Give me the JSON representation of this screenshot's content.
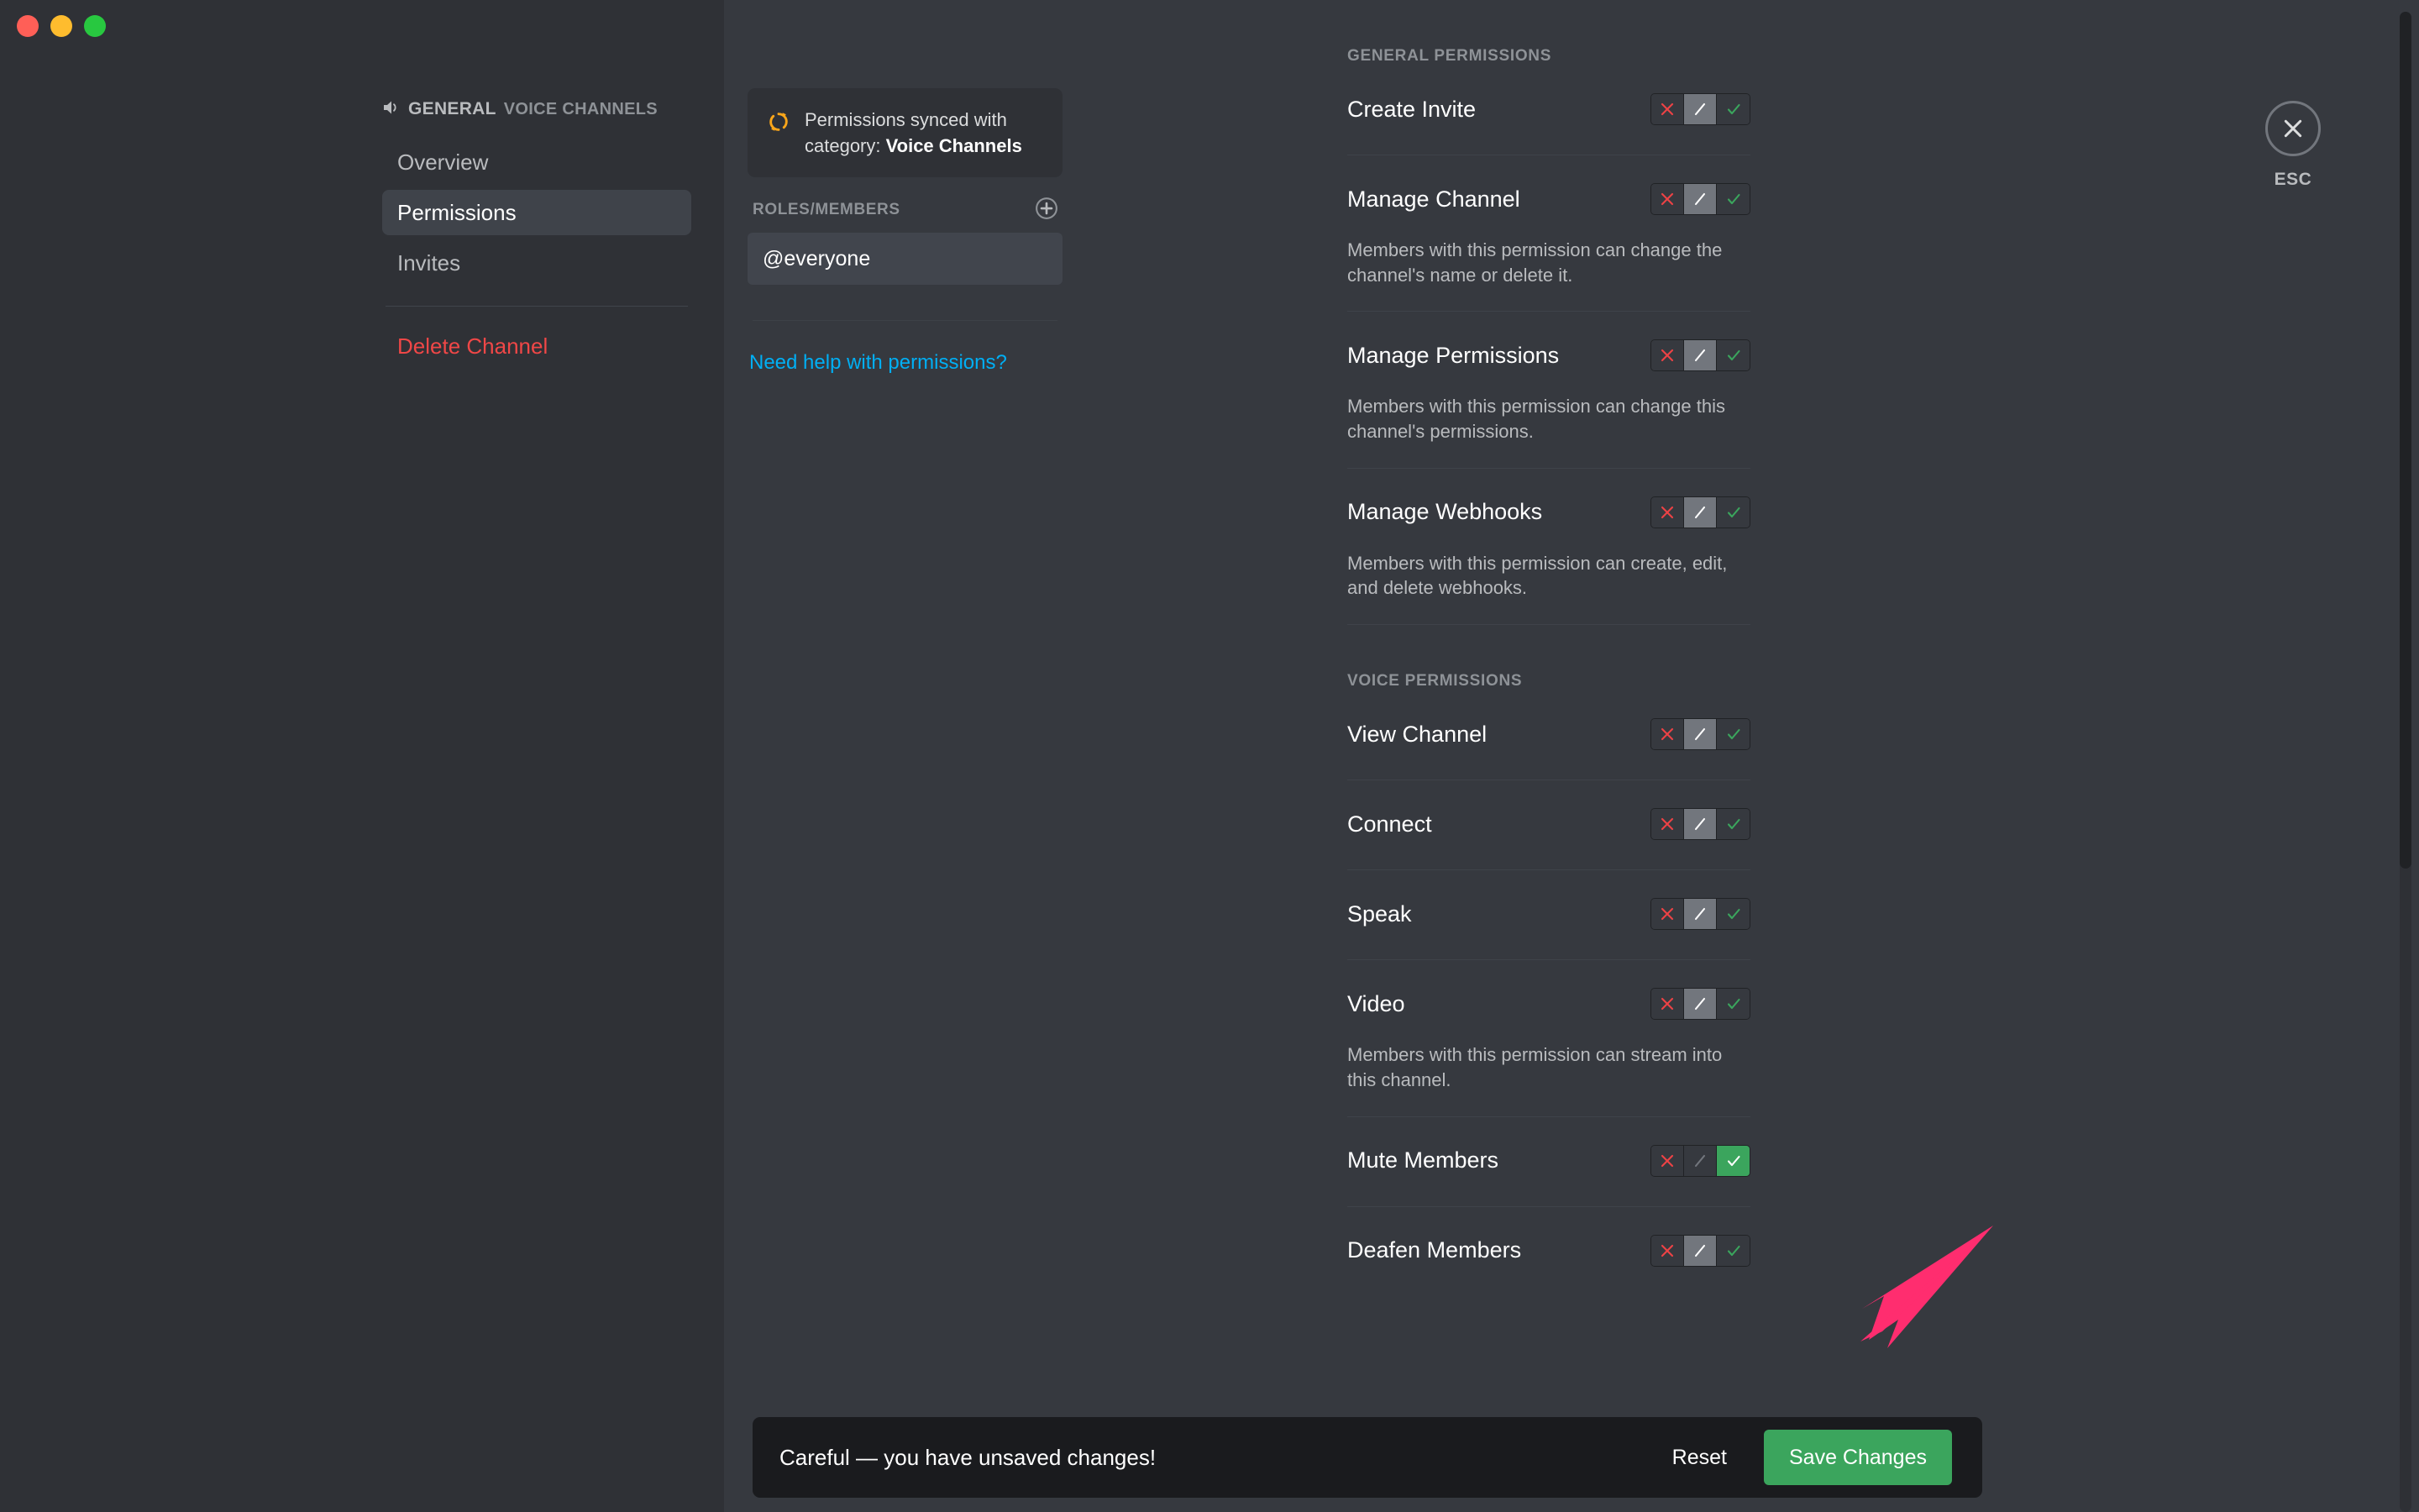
{
  "window": {
    "traffic_lights": [
      "close",
      "minimize",
      "maximize"
    ],
    "colors": {
      "close": "#ff5f57",
      "minimize": "#febc2e",
      "maximize": "#28c840"
    }
  },
  "sidebar": {
    "breadcrumb": {
      "icon": "speaker-icon",
      "channel_name": "GENERAL",
      "category": "VOICE CHANNELS"
    },
    "items": [
      {
        "label": "Overview",
        "active": false
      },
      {
        "label": "Permissions",
        "active": true
      },
      {
        "label": "Invites",
        "active": false
      }
    ],
    "danger_label": "Delete Channel",
    "danger_color": "#f04747"
  },
  "roles_panel": {
    "sync_notice": {
      "icon": "sync-icon",
      "icon_color": "#faa61a",
      "text_prefix": "Permissions synced with category: ",
      "category": "Voice Channels"
    },
    "roles_header": "ROLES/MEMBERS",
    "add_icon": "plus-circle-icon",
    "roles": [
      {
        "label": "@everyone",
        "selected": true
      }
    ],
    "help_link": "Need help with permissions?",
    "help_link_color": "#00aff4"
  },
  "permissions": {
    "sections": [
      {
        "title": "GENERAL PERMISSIONS",
        "rows": [
          {
            "name": "Create Invite",
            "desc": "",
            "state": "neutral"
          },
          {
            "name": "Manage Channel",
            "desc": "Members with this permission can change the channel's name or delete it.",
            "state": "neutral"
          },
          {
            "name": "Manage Permissions",
            "desc": "Members with this permission can change this channel's permissions.",
            "state": "neutral"
          },
          {
            "name": "Manage Webhooks",
            "desc": "Members with this permission can create, edit, and delete webhooks.",
            "state": "neutral"
          }
        ]
      },
      {
        "title": "VOICE PERMISSIONS",
        "rows": [
          {
            "name": "View Channel",
            "desc": "",
            "state": "neutral"
          },
          {
            "name": "Connect",
            "desc": "",
            "state": "neutral"
          },
          {
            "name": "Speak",
            "desc": "",
            "state": "neutral"
          },
          {
            "name": "Video",
            "desc": "Members with this permission can stream into this channel.",
            "state": "neutral"
          },
          {
            "name": "Mute Members",
            "desc": "",
            "state": "allow"
          },
          {
            "name": "Deafen Members",
            "desc": "",
            "state": "neutral"
          }
        ]
      }
    ],
    "toggle": {
      "deny_icon": "x-icon",
      "neutral_icon": "slash-icon",
      "allow_icon": "check-icon",
      "deny_color": "#ed4245",
      "allow_color": "#3ba55d",
      "neutral_bg": "#72767d",
      "allow_bg": "#3ba55d"
    }
  },
  "close": {
    "icon": "close-x-icon",
    "label": "ESC"
  },
  "save_bar": {
    "message": "Careful — you have unsaved changes!",
    "reset_label": "Reset",
    "save_label": "Save Changes",
    "save_color": "#3ba55d"
  },
  "annotation": {
    "arrow_color": "#ff2d6f",
    "points_to": "Save Changes"
  }
}
